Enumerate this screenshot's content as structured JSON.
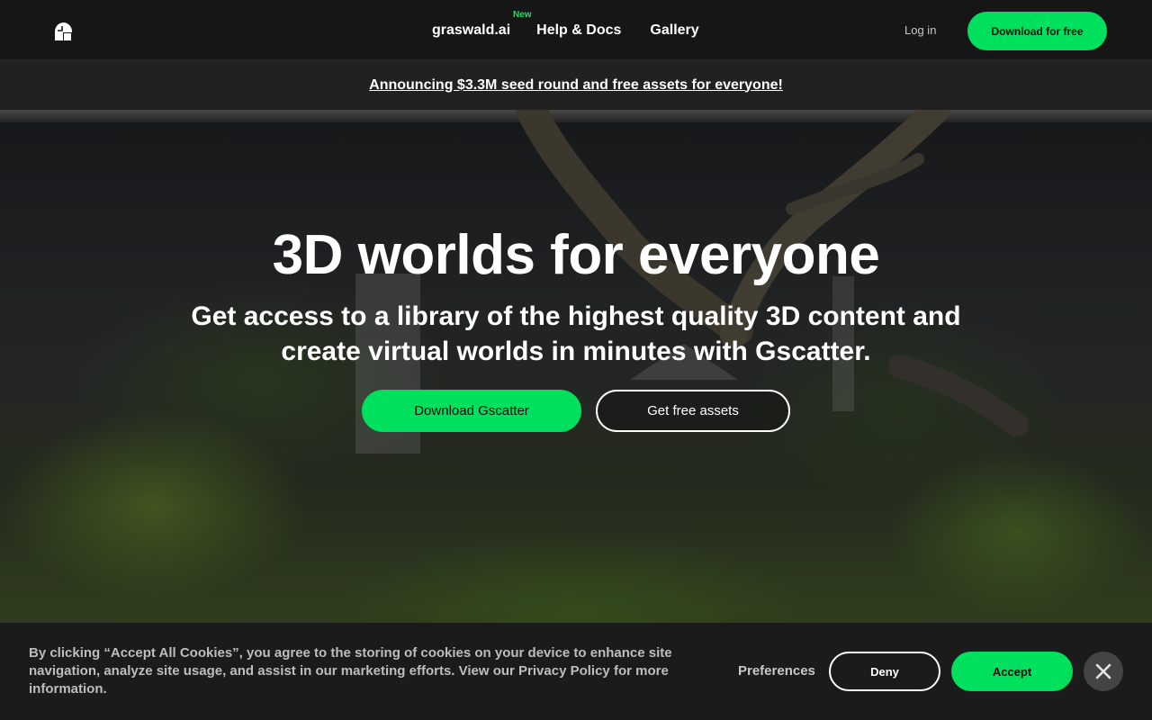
{
  "nav": {
    "logo_icon": "gscatter-logo-icon",
    "links": [
      {
        "label": "graswald.ai",
        "badge": "New"
      },
      {
        "label": "Help & Docs"
      },
      {
        "label": "Gallery"
      }
    ],
    "login_label": "Log in",
    "cta_label": "Download for free"
  },
  "announcement": {
    "text": "Announcing $3.3M seed round and free assets for everyone!"
  },
  "hero": {
    "title": "3D worlds for everyone",
    "subtitle": "Get access to a library of the highest quality 3D content and create virtual worlds in minutes with Gscatter.",
    "primary_button": "Download Gscatter",
    "secondary_button": "Get free assets"
  },
  "cookie_banner": {
    "text": "By clicking “Accept All Cookies”, you agree to the storing of cookies on your device to enhance site navigation, analyze site usage, and assist in our marketing efforts. View our Privacy Policy for more information.",
    "preferences_label": "Preferences",
    "deny_label": "Deny",
    "accept_label": "Accept",
    "close_icon": "close-icon"
  },
  "colors": {
    "accent": "#00e05f",
    "nav_background": "#161616",
    "announcement_background": "#212121",
    "cookie_background": "#1b1b1b"
  }
}
